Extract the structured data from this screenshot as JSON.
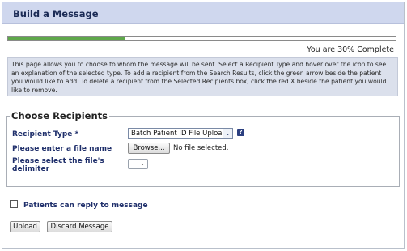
{
  "header": {
    "title": "Build a Message"
  },
  "progress": {
    "percent": 30,
    "label": "You are 30% Complete"
  },
  "info_text": "This page allows you to choose to whom the message will be sent. Select a Recipient Type and hover over the icon to see an explanation of the selected type. To add a recipient from the Search Results, click the green arrow beside the patient you would like to add. To delete a recipient from the Selected Recipients box, click the red X beside the patient you would like to remove.",
  "recipients": {
    "legend": "Choose Recipients",
    "recipient_type_label": "Recipient Type *",
    "recipient_type_value": "Batch Patient ID File Upload",
    "file_label": "Please enter a file name",
    "browse_label": "Browse...",
    "file_status": "No file selected.",
    "delimiter_label": "Please select the file's delimiter",
    "delimiter_value": ""
  },
  "reply": {
    "label": "Patients can reply to message",
    "checked": false
  },
  "actions": {
    "upload_label": "Upload",
    "discard_label": "Discard Message"
  },
  "colors": {
    "header_bg": "#cfd7ee",
    "progress_fill": "#5fa84a",
    "label_color": "#1f2f6b",
    "info_bg": "#dbe0ec"
  },
  "icons": {
    "help": "help-icon",
    "dropdown": "chevron-down-icon"
  }
}
